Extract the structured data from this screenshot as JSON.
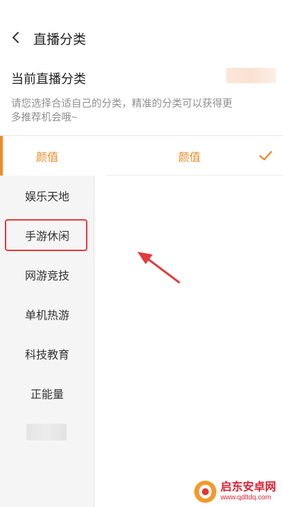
{
  "header": {
    "title": "直播分类"
  },
  "current": {
    "label": "当前直播分类"
  },
  "hint": "请您选择合适自己的分类，精准的分类可以获得更多推荐机会哦~",
  "sidebar": {
    "items": [
      {
        "label": "颜值",
        "active": true
      },
      {
        "label": "娱乐天地"
      },
      {
        "label": "手游休闲"
      },
      {
        "label": "网游竞技"
      },
      {
        "label": "单机热游"
      },
      {
        "label": "科技教育"
      },
      {
        "label": "正能量"
      }
    ]
  },
  "content": {
    "selected_label": "颜值"
  },
  "watermark": {
    "name": "启东安卓网",
    "url": "www.qdltdq.com"
  },
  "colors": {
    "accent": "#f08a24",
    "annotation": "#e23a3a"
  }
}
